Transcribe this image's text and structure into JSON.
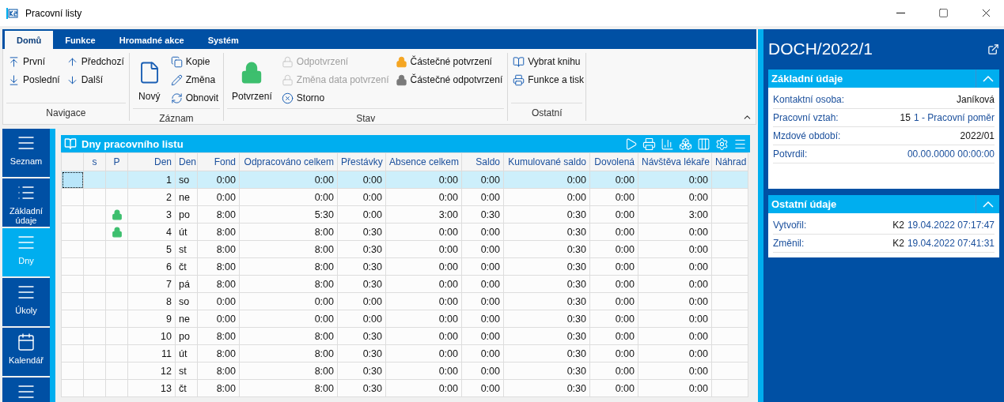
{
  "window": {
    "title": "Pracovní listy"
  },
  "ribbon": {
    "tabs": [
      {
        "label": "Domů",
        "selected": true
      },
      {
        "label": "Funkce",
        "selected": false
      },
      {
        "label": "Hromadné akce",
        "selected": false
      },
      {
        "label": "Systém",
        "selected": false
      }
    ],
    "groups": [
      {
        "label": "Navigace",
        "columns": [
          [
            {
              "label": "První",
              "kind": "small",
              "disabled": false
            },
            {
              "label": "Poslední",
              "kind": "small",
              "disabled": false
            }
          ],
          [
            {
              "label": "Předchozí",
              "kind": "small",
              "disabled": false
            },
            {
              "label": "Další",
              "kind": "small",
              "disabled": false
            }
          ]
        ]
      },
      {
        "label": "Záznam",
        "columns": [
          [
            {
              "label": "Nový",
              "kind": "large",
              "disabled": false
            }
          ],
          [
            {
              "label": "Kopie",
              "kind": "small",
              "disabled": false
            },
            {
              "label": "Změna",
              "kind": "small",
              "disabled": false
            },
            {
              "label": "Obnovit",
              "kind": "small",
              "disabled": false
            }
          ]
        ]
      },
      {
        "label": "Stav",
        "columns": [
          [
            {
              "label": "Potvrzení",
              "kind": "large",
              "disabled": false,
              "color": "#3dbf6e"
            }
          ],
          [
            {
              "label": "Odpotvrzení",
              "kind": "small",
              "disabled": true,
              "color": "#c8c8c8"
            },
            {
              "label": "Změna data potvrzení",
              "kind": "small",
              "disabled": true,
              "color": "#c8c8c8"
            },
            {
              "label": "Storno",
              "kind": "small",
              "disabled": false
            }
          ],
          [
            {
              "label": "Částečné potvrzení",
              "kind": "small",
              "disabled": false,
              "color": "#f5a623"
            },
            {
              "label": "Částečné odpotvrzení",
              "kind": "small",
              "disabled": false,
              "color": "#7a7a7a"
            }
          ]
        ]
      },
      {
        "label": "Ostatní",
        "columns": [
          [
            {
              "label": "Vybrat knihu",
              "kind": "small",
              "disabled": false
            },
            {
              "label": "Funkce a tisk",
              "kind": "small",
              "disabled": false
            }
          ]
        ]
      }
    ]
  },
  "nav": [
    {
      "label": "Seznam",
      "selected": false
    },
    {
      "label": "Základní údaje",
      "selected": false
    },
    {
      "label": "Dny",
      "selected": true
    },
    {
      "label": "Úkoly",
      "selected": false
    },
    {
      "label": "Kalendář",
      "selected": false
    },
    {
      "selected": false
    }
  ],
  "grid": {
    "title": "Dny pracovního listu",
    "columns": [
      "s",
      "P",
      "Den",
      "Den",
      "Fond",
      "Odpracováno celkem",
      "Přestávky",
      "Absence celkem",
      "Saldo",
      "Kumulované saldo",
      "Dovolená",
      "Návštěva lékaře",
      "Náhrad"
    ],
    "rows": [
      {
        "selected": true,
        "locked": false,
        "cells": [
          "",
          "",
          "1",
          "so",
          "0:00",
          "0:00",
          "0:00",
          "0:00",
          "0:00",
          "0:00",
          "0:00",
          "0:00",
          ""
        ]
      },
      {
        "selected": false,
        "locked": false,
        "cells": [
          "",
          "",
          "2",
          "ne",
          "0:00",
          "0:00",
          "0:00",
          "0:00",
          "0:00",
          "0:00",
          "0:00",
          "0:00",
          ""
        ]
      },
      {
        "selected": false,
        "locked": true,
        "cells": [
          "",
          "",
          "3",
          "po",
          "8:00",
          "5:30",
          "0:00",
          "3:00",
          "0:30",
          "0:30",
          "0:00",
          "3:00",
          ""
        ]
      },
      {
        "selected": false,
        "locked": true,
        "cells": [
          "",
          "",
          "4",
          "út",
          "8:00",
          "8:00",
          "0:30",
          "0:00",
          "0:00",
          "0:30",
          "0:00",
          "0:00",
          ""
        ]
      },
      {
        "selected": false,
        "locked": false,
        "cells": [
          "",
          "",
          "5",
          "st",
          "8:00",
          "8:00",
          "0:30",
          "0:00",
          "0:00",
          "0:30",
          "0:00",
          "0:00",
          ""
        ]
      },
      {
        "selected": false,
        "locked": false,
        "cells": [
          "",
          "",
          "6",
          "čt",
          "8:00",
          "8:00",
          "0:30",
          "0:00",
          "0:00",
          "0:30",
          "0:00",
          "0:00",
          ""
        ]
      },
      {
        "selected": false,
        "locked": false,
        "cells": [
          "",
          "",
          "7",
          "pá",
          "8:00",
          "8:00",
          "0:30",
          "0:00",
          "0:00",
          "0:30",
          "0:00",
          "0:00",
          ""
        ]
      },
      {
        "selected": false,
        "locked": false,
        "cells": [
          "",
          "",
          "8",
          "so",
          "0:00",
          "0:00",
          "0:00",
          "0:00",
          "0:00",
          "0:30",
          "0:00",
          "0:00",
          ""
        ]
      },
      {
        "selected": false,
        "locked": false,
        "cells": [
          "",
          "",
          "9",
          "ne",
          "0:00",
          "0:00",
          "0:00",
          "0:00",
          "0:00",
          "0:30",
          "0:00",
          "0:00",
          ""
        ]
      },
      {
        "selected": false,
        "locked": false,
        "cells": [
          "",
          "",
          "10",
          "po",
          "8:00",
          "8:00",
          "0:30",
          "0:00",
          "0:00",
          "0:30",
          "0:00",
          "0:00",
          ""
        ]
      },
      {
        "selected": false,
        "locked": false,
        "cells": [
          "",
          "",
          "11",
          "út",
          "8:00",
          "8:00",
          "0:30",
          "0:00",
          "0:00",
          "0:30",
          "0:00",
          "0:00",
          ""
        ]
      },
      {
        "selected": false,
        "locked": false,
        "cells": [
          "",
          "",
          "12",
          "st",
          "8:00",
          "8:00",
          "0:30",
          "0:00",
          "0:00",
          "0:30",
          "0:00",
          "0:00",
          ""
        ]
      },
      {
        "selected": false,
        "locked": false,
        "cells": [
          "",
          "",
          "13",
          "čt",
          "8:00",
          "8:00",
          "0:30",
          "0:00",
          "0:00",
          "0:30",
          "0:00",
          "0:00",
          ""
        ]
      }
    ]
  },
  "detail": {
    "title": "DOCH/2022/1",
    "sections": [
      {
        "title": "Základní údaje",
        "expanded": true,
        "fields": [
          {
            "label": "Kontaktní osoba:",
            "value": "Janíková"
          },
          {
            "label": "Pracovní vztah:",
            "prefix": "15",
            "value": "1 - Pracovní poměr",
            "link": true
          },
          {
            "label": "Mzdové období:",
            "value": "2022/01"
          },
          {
            "label": "Potvrdil:",
            "value": "00.00.0000 00:00:00",
            "link": true
          }
        ]
      },
      {
        "title": "Ostatní údaje",
        "expanded": true,
        "fields": [
          {
            "label": "Vytvořil:",
            "prefix": "K2",
            "value": "19.04.2022 07:17:47",
            "link": true
          },
          {
            "label": "Změnil:",
            "prefix": "K2",
            "value": "19.04.2022 07:41:31",
            "link": true
          }
        ]
      }
    ]
  }
}
